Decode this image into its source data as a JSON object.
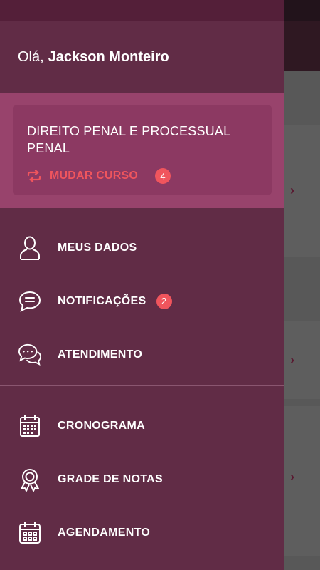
{
  "greeting": {
    "hello": "Olá,",
    "name": "Jackson Monteiro"
  },
  "course": {
    "title": "DIREITO PENAL E PROCESSUAL PENAL",
    "change_label": "MUDAR CURSO",
    "change_icon": "swap-icon",
    "count": "4"
  },
  "menu_primary": [
    {
      "label": "MEUS DADOS",
      "icon": "user-icon"
    },
    {
      "label": "NOTIFICAÇÕES",
      "icon": "chat-bubble-icon",
      "badge": "2"
    },
    {
      "label": "ATENDIMENTO",
      "icon": "chat-bubbles-icon"
    }
  ],
  "menu_secondary": [
    {
      "label": "CRONOGRAMA",
      "icon": "calendar-icon"
    },
    {
      "label": "GRADE DE NOTAS",
      "icon": "award-icon"
    },
    {
      "label": "AGENDAMENTO",
      "icon": "calendar-grid-icon"
    }
  ],
  "colors": {
    "drawer_bg": "#612c46",
    "course_section_bg": "#98436c",
    "accent_red": "#f0555d"
  }
}
